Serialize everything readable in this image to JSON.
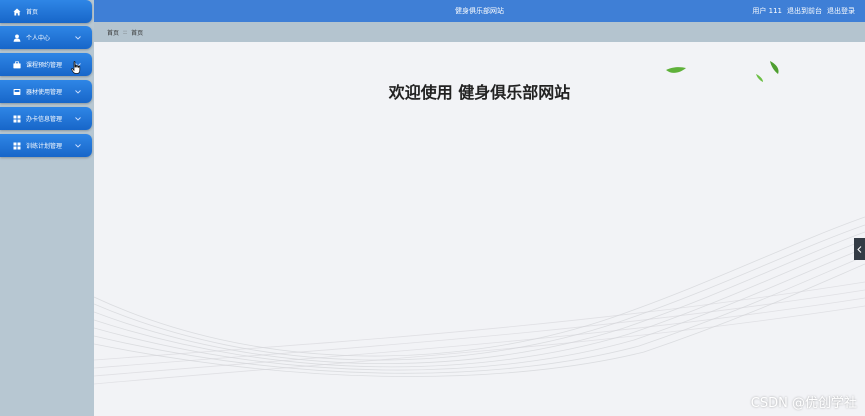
{
  "app": {
    "title": "健身俱乐部网站"
  },
  "header": {
    "user_label": "用户 111",
    "back_label": "退出到前台",
    "logout_label": "退出登录",
    "bar_color": "#3f7fd6"
  },
  "sidebar": {
    "items": [
      {
        "label": "首页",
        "icon": "home-icon",
        "has_arrow": false
      },
      {
        "label": "个人中心",
        "icon": "user-icon",
        "has_arrow": true
      },
      {
        "label": "课程预约管理",
        "icon": "briefcase-icon",
        "has_arrow": true
      },
      {
        "label": "器材使用管理",
        "icon": "device-icon",
        "has_arrow": true
      },
      {
        "label": "办卡信息管理",
        "icon": "grid-icon",
        "has_arrow": true
      },
      {
        "label": "训练计划管理",
        "icon": "grid-icon",
        "has_arrow": true
      }
    ],
    "item_color": "#1f74da"
  },
  "breadcrumb": {
    "root": "首页",
    "separator": "::",
    "current": "首页"
  },
  "main": {
    "welcome": "欢迎使用 健身俱乐部网站"
  },
  "watermark": "CSDN @优创学社"
}
